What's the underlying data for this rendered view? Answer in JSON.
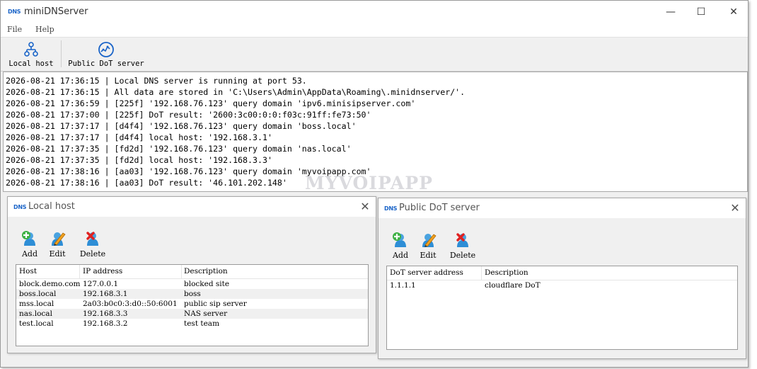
{
  "app": {
    "logo": "DNS",
    "title": "miniDNServer",
    "controls": {
      "minimize": "—",
      "maximize": "☐",
      "close": "✕"
    }
  },
  "menu": [
    {
      "label": "File"
    },
    {
      "label": "Help"
    }
  ],
  "toolbar": [
    {
      "label": "Local host",
      "icon": "network-icon"
    },
    {
      "label": "Public DoT server",
      "icon": "globe-icon"
    }
  ],
  "log": [
    "2026-08-21 17:36:15 | Local DNS server is running at port 53.",
    "2026-08-21 17:36:15 | All data are stored in 'C:\\Users\\Admin\\AppData\\Roaming\\.minidnserver/'.",
    "2026-08-21 17:36:59 | [225f] '192.168.76.123' query domain 'ipv6.minisipserver.com'",
    "2026-08-21 17:37:00 | [225f] DoT result: '2600:3c00:0:0:f03c:91ff:fe73:50'",
    "2026-08-21 17:37:17 | [d4f4] '192.168.76.123' query domain 'boss.local'",
    "2026-08-21 17:37:17 | [d4f4] local host: '192.168.3.1'",
    "2026-08-21 17:37:35 | [fd2d] '192.168.76.123' query domain 'nas.local'",
    "2026-08-21 17:37:35 | [fd2d] local host: '192.168.3.3'",
    "2026-08-21 17:38:16 | [aa03] '192.168.76.123' query domain 'myvoipapp.com'",
    "2026-08-21 17:38:16 | [aa03] DoT result: '46.101.202.148'"
  ],
  "watermark": "MYVOIPAPP",
  "local_host": {
    "logo": "DNS",
    "title": "Local host",
    "close": "✕",
    "actions": [
      {
        "label": "Add"
      },
      {
        "label": "Edit"
      },
      {
        "label": "Delete"
      }
    ],
    "columns": [
      "Host",
      "IP address",
      "Description"
    ],
    "rows": [
      [
        "block.demo.com",
        "127.0.0.1",
        "blocked site"
      ],
      [
        "boss.local",
        "192.168.3.1",
        "boss"
      ],
      [
        "mss.local",
        "2a03:b0c0:3:d0::50:6001",
        "public sip server"
      ],
      [
        "nas.local",
        "192.168.3.3",
        "NAS server"
      ],
      [
        "test.local",
        "192.168.3.2",
        "test team"
      ]
    ]
  },
  "dot_server": {
    "logo": "DNS",
    "title": "Public DoT server",
    "close": "✕",
    "actions": [
      {
        "label": "Add"
      },
      {
        "label": "Edit"
      },
      {
        "label": "Delete"
      }
    ],
    "columns": [
      "DoT server address",
      "Description"
    ],
    "rows": [
      [
        "1.1.1.1",
        "cloudflare DoT"
      ]
    ]
  }
}
